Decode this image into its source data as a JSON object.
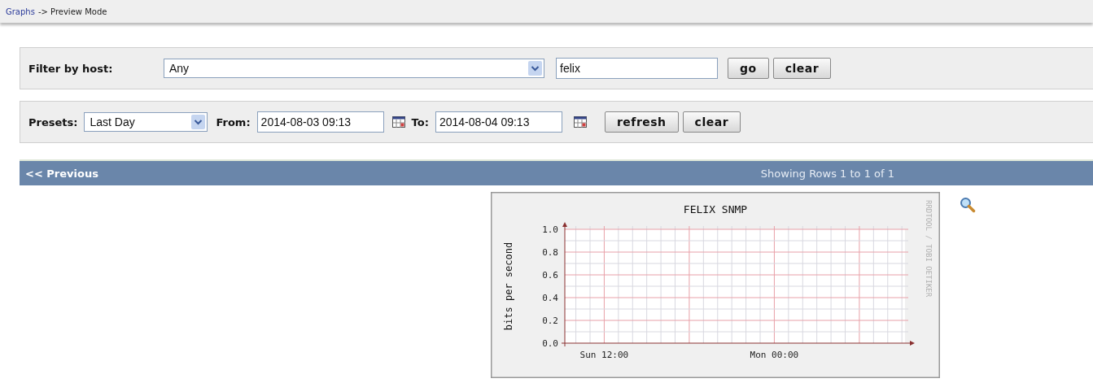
{
  "breadcrumb": {
    "link": "Graphs",
    "text": "-> Preview Mode"
  },
  "host_filter": {
    "label": "Filter by host:",
    "host_select": "Any",
    "search_value": "felix",
    "buttons": [
      "go",
      "clear"
    ]
  },
  "time_filter": {
    "presets_label": "Presets:",
    "preset": "Last Day",
    "from_label": "From:",
    "from_value": "2014-08-03 09:13",
    "to_label": "To:",
    "to_value": "2014-08-04 09:13",
    "buttons": [
      "refresh",
      "clear"
    ]
  },
  "pager": {
    "previous": "<< Previous",
    "status": "Showing Rows 1 to 1 of 1"
  },
  "graph": {
    "credit": "RRDTOOL / TOBI OETIKER",
    "chart_data": {
      "type": "line",
      "title": "FELIX SNMP",
      "ylabel": "bits per second",
      "grid": true,
      "ylim": [
        0,
        1
      ],
      "yticks": [
        {
          "value": 0,
          "label": "0.0"
        },
        {
          "value": 0.2,
          "label": "0.2"
        },
        {
          "value": 0.4,
          "label": "0.4"
        },
        {
          "value": 0.6,
          "label": "0.6"
        },
        {
          "value": 0.8,
          "label": "0.8"
        },
        {
          "value": 1,
          "label": "1.0"
        }
      ],
      "categories": [
        null,
        null,
        "Sun 12:00",
        null,
        null,
        null,
        null,
        null,
        null,
        null,
        null,
        null,
        null,
        null,
        "Mon 00:00",
        null,
        null,
        null,
        null,
        null,
        null,
        null,
        null,
        null
      ]
    }
  }
}
